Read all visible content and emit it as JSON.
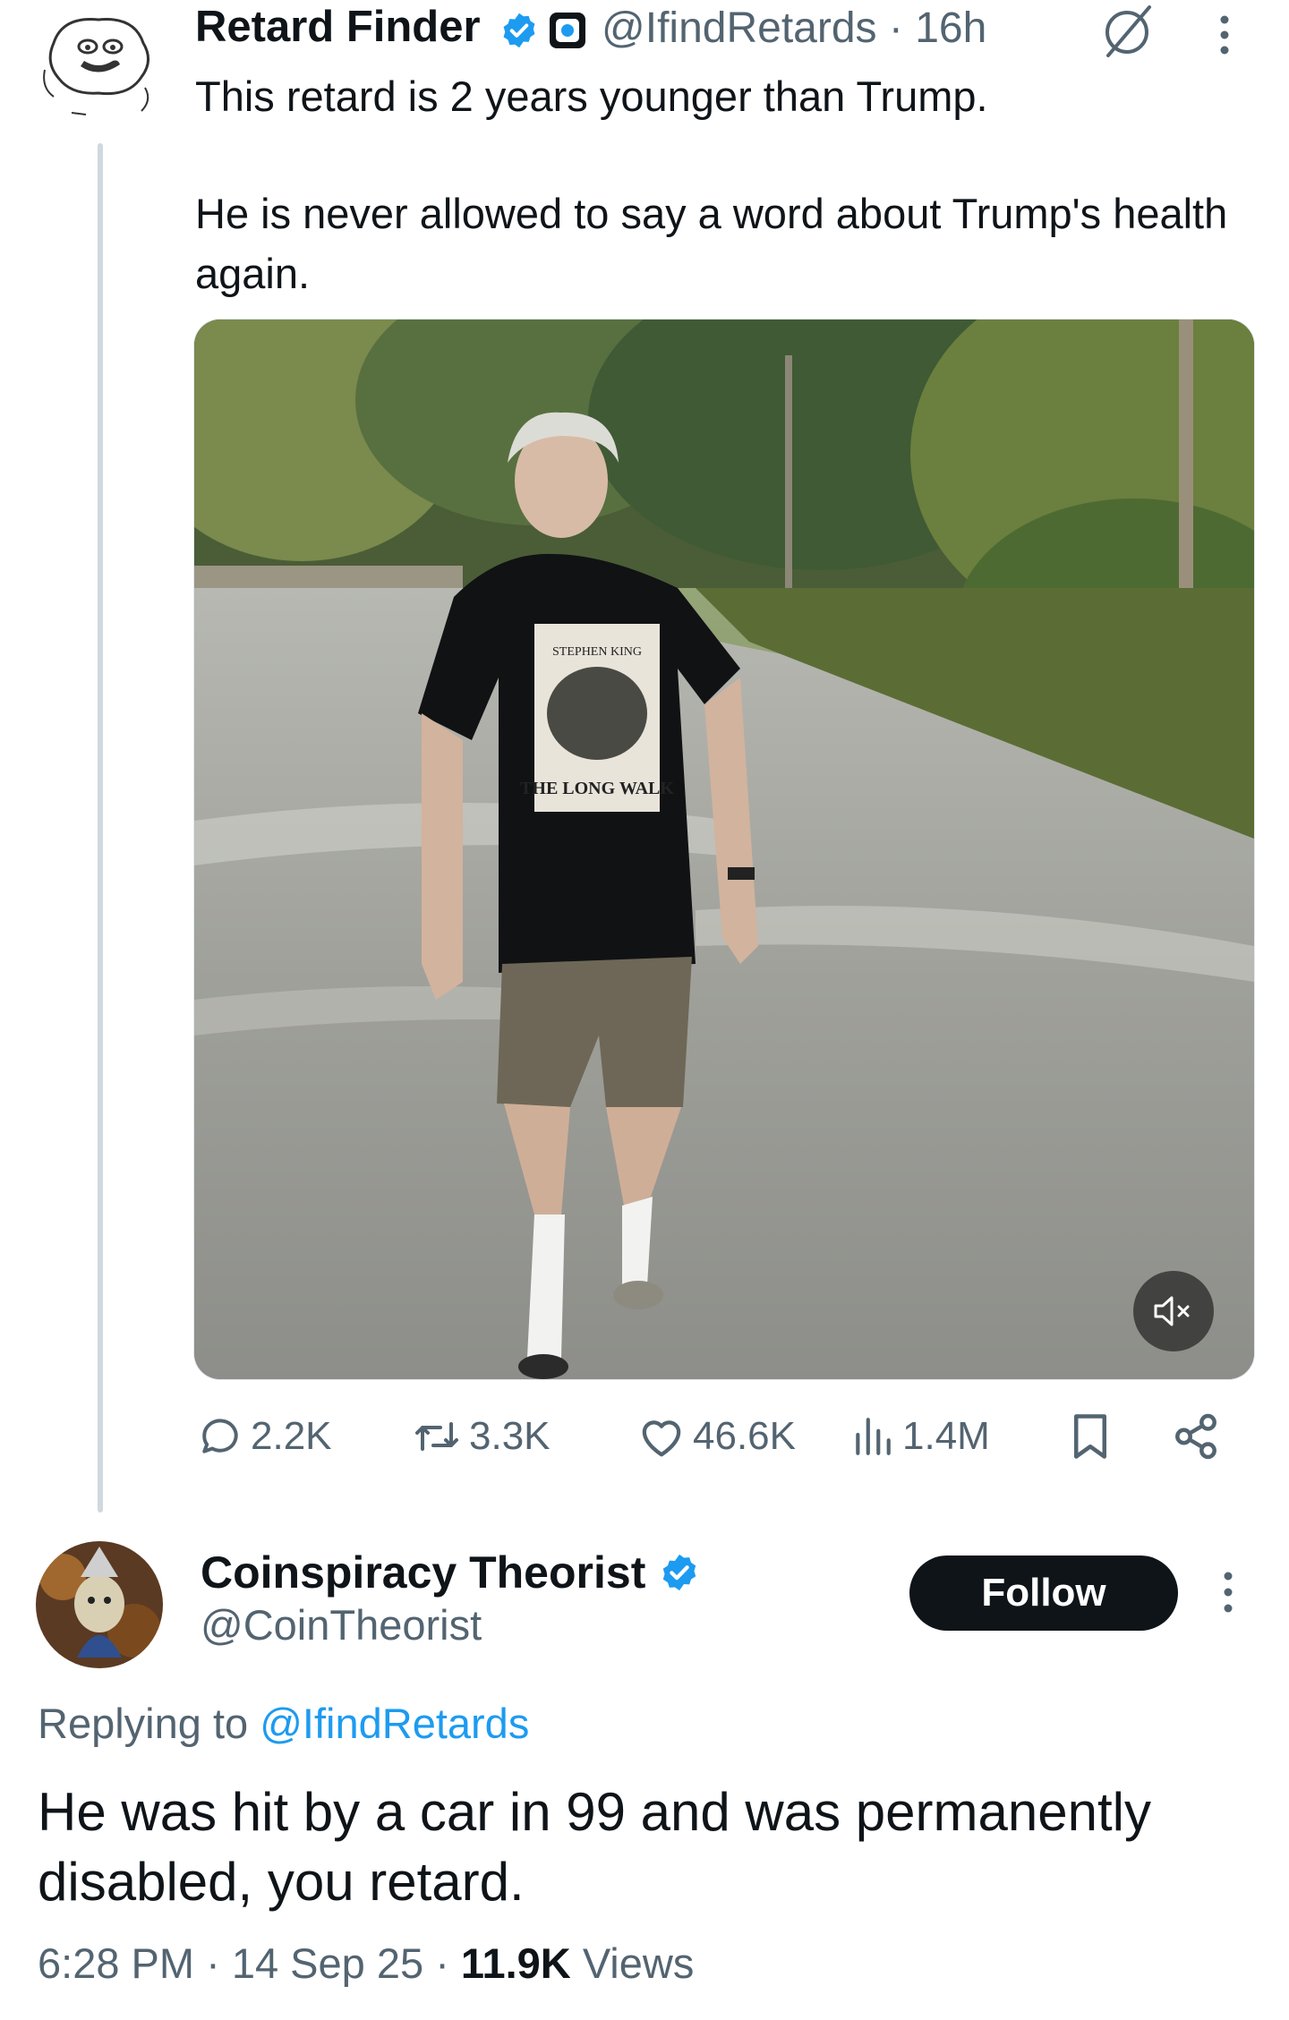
{
  "parent_tweet": {
    "display_name": "Retard Finder",
    "handle": "@IfindRetards",
    "separator": "·",
    "time_ago": "16h",
    "text_line1": "This retard is 2 years younger than Trump.",
    "text_line2": "He is never allowed to say a word about Trump's health again.",
    "media": {
      "kind": "video",
      "shirt_text_top": "STEPHEN KING",
      "shirt_text_bottom": "THE LONG WALK",
      "muted": true
    },
    "stats": {
      "replies": "2.2K",
      "reposts": "3.3K",
      "likes": "46.6K",
      "views": "1.4M"
    }
  },
  "reply_tweet": {
    "display_name": "Coinspiracy Theorist",
    "handle": "@CoinTheorist",
    "follow_label": "Follow",
    "replying_prefix": "Replying to",
    "replying_handle": "@IfindRetards",
    "text": "He was hit by a car in 99 and was permanently disabled, you retard.",
    "time": "6:28 PM",
    "date": "14 Sep 25",
    "views_count": "11.9K",
    "views_label": "Views",
    "separator": "·"
  },
  "colors": {
    "text_primary": "#0f1419",
    "text_secondary": "#536471",
    "accent_blue": "#1d9bf0",
    "thread_line": "#cfd9de",
    "follow_bg": "#0f1419"
  },
  "icons": [
    "verified-badge-icon",
    "affiliate-badge-icon",
    "grok-icon",
    "more-options-icon",
    "mute-icon",
    "reply-icon",
    "repost-icon",
    "like-icon",
    "views-icon",
    "bookmark-icon",
    "share-icon"
  ]
}
